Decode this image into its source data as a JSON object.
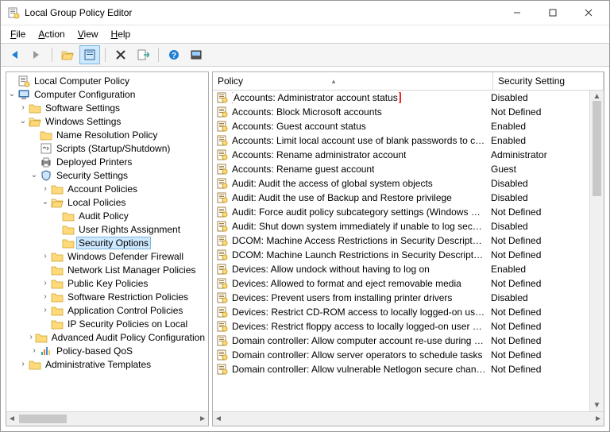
{
  "window": {
    "title": "Local Group Policy Editor"
  },
  "menu": {
    "file": "File",
    "action": "Action",
    "view": "View",
    "help": "Help"
  },
  "tree": {
    "root": "Local Computer Policy",
    "cc": "Computer Configuration",
    "ss": "Software Settings",
    "ws": "Windows Settings",
    "nrp": "Name Resolution Policy",
    "scripts": "Scripts (Startup/Shutdown)",
    "dp": "Deployed Printers",
    "sec": "Security Settings",
    "ap": "Account Policies",
    "lp": "Local Policies",
    "audit": "Audit Policy",
    "ura": "User Rights Assignment",
    "so": "Security Options",
    "wdf": "Windows Defender Firewall",
    "nlmp": "Network List Manager Policies",
    "pkp": "Public Key Policies",
    "srp": "Software Restriction Policies",
    "acp": "Application Control Policies",
    "ipsec": "IP Security Policies on Local",
    "aapc": "Advanced Audit Policy Configuration",
    "qos": "Policy-based QoS",
    "at": "Administrative Templates"
  },
  "list": {
    "col_policy": "Policy",
    "col_setting": "Security Setting",
    "rows": [
      {
        "name": "Accounts: Administrator account status",
        "value": "Disabled",
        "hl": true
      },
      {
        "name": "Accounts: Block Microsoft accounts",
        "value": "Not Defined"
      },
      {
        "name": "Accounts: Guest account status",
        "value": "Enabled"
      },
      {
        "name": "Accounts: Limit local account use of blank passwords to co...",
        "value": "Enabled"
      },
      {
        "name": "Accounts: Rename administrator account",
        "value": "Administrator"
      },
      {
        "name": "Accounts: Rename guest account",
        "value": "Guest"
      },
      {
        "name": "Audit: Audit the access of global system objects",
        "value": "Disabled"
      },
      {
        "name": "Audit: Audit the use of Backup and Restore privilege",
        "value": "Disabled"
      },
      {
        "name": "Audit: Force audit policy subcategory settings (Windows Vis...",
        "value": "Not Defined"
      },
      {
        "name": "Audit: Shut down system immediately if unable to log secur...",
        "value": "Disabled"
      },
      {
        "name": "DCOM: Machine Access Restrictions in Security Descriptor D...",
        "value": "Not Defined"
      },
      {
        "name": "DCOM: Machine Launch Restrictions in Security Descriptor D...",
        "value": "Not Defined"
      },
      {
        "name": "Devices: Allow undock without having to log on",
        "value": "Enabled"
      },
      {
        "name": "Devices: Allowed to format and eject removable media",
        "value": "Not Defined"
      },
      {
        "name": "Devices: Prevent users from installing printer drivers",
        "value": "Disabled"
      },
      {
        "name": "Devices: Restrict CD-ROM access to locally logged-on user ...",
        "value": "Not Defined"
      },
      {
        "name": "Devices: Restrict floppy access to locally logged-on user only",
        "value": "Not Defined"
      },
      {
        "name": "Domain controller: Allow computer account re-use during d...",
        "value": "Not Defined"
      },
      {
        "name": "Domain controller: Allow server operators to schedule tasks",
        "value": "Not Defined"
      },
      {
        "name": "Domain controller: Allow vulnerable Netlogon secure chann...",
        "value": "Not Defined"
      }
    ]
  }
}
